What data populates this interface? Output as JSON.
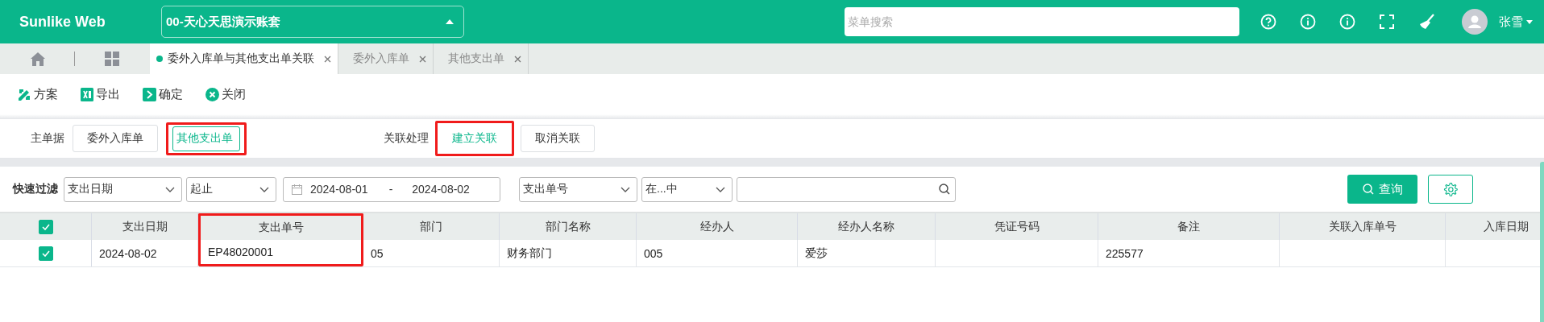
{
  "header": {
    "logo": "Sunlike Web",
    "account": "00-天心天思演示账套",
    "search": {
      "placeholder": "菜单搜索"
    },
    "user": "张雪"
  },
  "tabs": [
    {
      "label": "委外入库单与其他支出单关联",
      "selected": true
    },
    {
      "label": "委外入库单",
      "selected": false
    },
    {
      "label": "其他支出单",
      "selected": false
    }
  ],
  "toolbar": [
    {
      "kind": "scheme",
      "label": "方案"
    },
    {
      "kind": "export",
      "label": "导出"
    },
    {
      "kind": "confirm",
      "label": "确定"
    },
    {
      "kind": "close",
      "label": "关闭"
    }
  ],
  "main_doc": {
    "label": "主单据",
    "options": [
      {
        "label": "委外入库单",
        "selected": false,
        "highlighted": false
      },
      {
        "label": "其他支出单",
        "selected": true,
        "highlighted": true
      }
    ]
  },
  "relation": {
    "label": "关联处理",
    "buttons": [
      {
        "label": "建立关联",
        "kind": "primary",
        "highlighted": true
      },
      {
        "label": "取消关联",
        "kind": "default",
        "highlighted": false
      }
    ]
  },
  "filter": {
    "label": "快速过滤",
    "field": "支出日期",
    "mode": "起止",
    "date_from": "2024-08-01",
    "date_sep": "-",
    "date_to": "2024-08-02",
    "field2": "支出单号",
    "mode2": "在...中",
    "query_button": "查询"
  },
  "table": {
    "columns": [
      {
        "label": "支出日期",
        "highlighted": false
      },
      {
        "label": "支出单号",
        "highlighted": true
      },
      {
        "label": "部门",
        "highlighted": false
      },
      {
        "label": "部门名称",
        "highlighted": false
      },
      {
        "label": "经办人",
        "highlighted": false
      },
      {
        "label": "经办人名称",
        "highlighted": false
      },
      {
        "label": "凭证号码",
        "highlighted": false
      },
      {
        "label": "备注",
        "highlighted": false
      },
      {
        "label": "关联入库单号",
        "highlighted": false
      },
      {
        "label": "入库日期",
        "highlighted": false
      }
    ],
    "all_checked": true,
    "rows": [
      {
        "checked": true,
        "cells": [
          "2024-08-02",
          "EP48020001",
          "05",
          "财务部门",
          "005",
          "爱莎",
          null,
          "225577",
          null,
          null
        ]
      }
    ]
  }
}
